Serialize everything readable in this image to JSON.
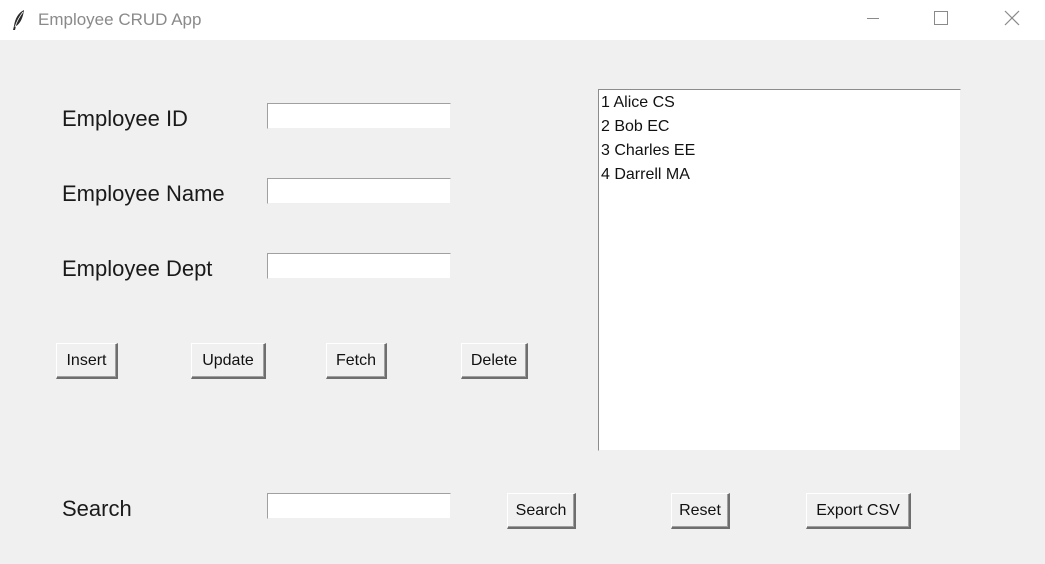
{
  "window": {
    "title": "Employee CRUD App",
    "icon": "feather-icon"
  },
  "form": {
    "id_label": "Employee ID",
    "name_label": "Employee Name",
    "dept_label": "Employee Dept",
    "id_value": "",
    "name_value": "",
    "dept_value": ""
  },
  "actions": {
    "insert": "Insert",
    "update": "Update",
    "fetch": "Fetch",
    "delete": "Delete"
  },
  "list": {
    "items": [
      "1 Alice CS",
      "2 Bob EC",
      "3 Charles EE",
      "4 Darrell MA"
    ]
  },
  "search": {
    "label": "Search",
    "value": "",
    "search_button": "Search",
    "reset_button": "Reset",
    "export_button": "Export CSV"
  }
}
